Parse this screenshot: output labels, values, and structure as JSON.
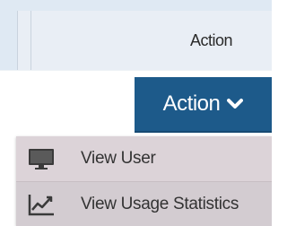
{
  "table": {
    "column_header": "Action"
  },
  "action_button": {
    "label": "Action"
  },
  "menu": {
    "items": [
      {
        "label": "View User",
        "icon": "monitor-icon"
      },
      {
        "label": "View Usage Statistics",
        "icon": "line-chart-icon"
      }
    ]
  },
  "colors": {
    "button_bg": "#1d5a8a",
    "menu_bg": "#dcd3d8",
    "header_bg": "#e9eef5"
  }
}
